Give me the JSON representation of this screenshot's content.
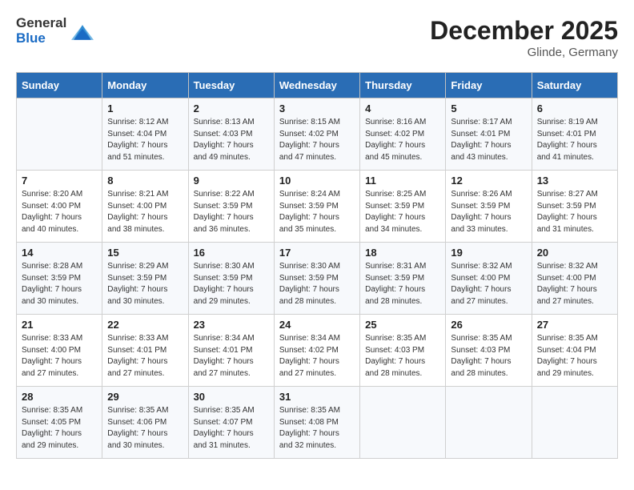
{
  "header": {
    "logo_general": "General",
    "logo_blue": "Blue",
    "month": "December 2025",
    "location": "Glinde, Germany"
  },
  "days_of_week": [
    "Sunday",
    "Monday",
    "Tuesday",
    "Wednesday",
    "Thursday",
    "Friday",
    "Saturday"
  ],
  "weeks": [
    [
      {
        "day": "",
        "sunrise": "",
        "sunset": "",
        "daylight": ""
      },
      {
        "day": "1",
        "sunrise": "Sunrise: 8:12 AM",
        "sunset": "Sunset: 4:04 PM",
        "daylight": "Daylight: 7 hours and 51 minutes."
      },
      {
        "day": "2",
        "sunrise": "Sunrise: 8:13 AM",
        "sunset": "Sunset: 4:03 PM",
        "daylight": "Daylight: 7 hours and 49 minutes."
      },
      {
        "day": "3",
        "sunrise": "Sunrise: 8:15 AM",
        "sunset": "Sunset: 4:02 PM",
        "daylight": "Daylight: 7 hours and 47 minutes."
      },
      {
        "day": "4",
        "sunrise": "Sunrise: 8:16 AM",
        "sunset": "Sunset: 4:02 PM",
        "daylight": "Daylight: 7 hours and 45 minutes."
      },
      {
        "day": "5",
        "sunrise": "Sunrise: 8:17 AM",
        "sunset": "Sunset: 4:01 PM",
        "daylight": "Daylight: 7 hours and 43 minutes."
      },
      {
        "day": "6",
        "sunrise": "Sunrise: 8:19 AM",
        "sunset": "Sunset: 4:01 PM",
        "daylight": "Daylight: 7 hours and 41 minutes."
      }
    ],
    [
      {
        "day": "7",
        "sunrise": "Sunrise: 8:20 AM",
        "sunset": "Sunset: 4:00 PM",
        "daylight": "Daylight: 7 hours and 40 minutes."
      },
      {
        "day": "8",
        "sunrise": "Sunrise: 8:21 AM",
        "sunset": "Sunset: 4:00 PM",
        "daylight": "Daylight: 7 hours and 38 minutes."
      },
      {
        "day": "9",
        "sunrise": "Sunrise: 8:22 AM",
        "sunset": "Sunset: 3:59 PM",
        "daylight": "Daylight: 7 hours and 36 minutes."
      },
      {
        "day": "10",
        "sunrise": "Sunrise: 8:24 AM",
        "sunset": "Sunset: 3:59 PM",
        "daylight": "Daylight: 7 hours and 35 minutes."
      },
      {
        "day": "11",
        "sunrise": "Sunrise: 8:25 AM",
        "sunset": "Sunset: 3:59 PM",
        "daylight": "Daylight: 7 hours and 34 minutes."
      },
      {
        "day": "12",
        "sunrise": "Sunrise: 8:26 AM",
        "sunset": "Sunset: 3:59 PM",
        "daylight": "Daylight: 7 hours and 33 minutes."
      },
      {
        "day": "13",
        "sunrise": "Sunrise: 8:27 AM",
        "sunset": "Sunset: 3:59 PM",
        "daylight": "Daylight: 7 hours and 31 minutes."
      }
    ],
    [
      {
        "day": "14",
        "sunrise": "Sunrise: 8:28 AM",
        "sunset": "Sunset: 3:59 PM",
        "daylight": "Daylight: 7 hours and 30 minutes."
      },
      {
        "day": "15",
        "sunrise": "Sunrise: 8:29 AM",
        "sunset": "Sunset: 3:59 PM",
        "daylight": "Daylight: 7 hours and 30 minutes."
      },
      {
        "day": "16",
        "sunrise": "Sunrise: 8:30 AM",
        "sunset": "Sunset: 3:59 PM",
        "daylight": "Daylight: 7 hours and 29 minutes."
      },
      {
        "day": "17",
        "sunrise": "Sunrise: 8:30 AM",
        "sunset": "Sunset: 3:59 PM",
        "daylight": "Daylight: 7 hours and 28 minutes."
      },
      {
        "day": "18",
        "sunrise": "Sunrise: 8:31 AM",
        "sunset": "Sunset: 3:59 PM",
        "daylight": "Daylight: 7 hours and 28 minutes."
      },
      {
        "day": "19",
        "sunrise": "Sunrise: 8:32 AM",
        "sunset": "Sunset: 4:00 PM",
        "daylight": "Daylight: 7 hours and 27 minutes."
      },
      {
        "day": "20",
        "sunrise": "Sunrise: 8:32 AM",
        "sunset": "Sunset: 4:00 PM",
        "daylight": "Daylight: 7 hours and 27 minutes."
      }
    ],
    [
      {
        "day": "21",
        "sunrise": "Sunrise: 8:33 AM",
        "sunset": "Sunset: 4:00 PM",
        "daylight": "Daylight: 7 hours and 27 minutes."
      },
      {
        "day": "22",
        "sunrise": "Sunrise: 8:33 AM",
        "sunset": "Sunset: 4:01 PM",
        "daylight": "Daylight: 7 hours and 27 minutes."
      },
      {
        "day": "23",
        "sunrise": "Sunrise: 8:34 AM",
        "sunset": "Sunset: 4:01 PM",
        "daylight": "Daylight: 7 hours and 27 minutes."
      },
      {
        "day": "24",
        "sunrise": "Sunrise: 8:34 AM",
        "sunset": "Sunset: 4:02 PM",
        "daylight": "Daylight: 7 hours and 27 minutes."
      },
      {
        "day": "25",
        "sunrise": "Sunrise: 8:35 AM",
        "sunset": "Sunset: 4:03 PM",
        "daylight": "Daylight: 7 hours and 28 minutes."
      },
      {
        "day": "26",
        "sunrise": "Sunrise: 8:35 AM",
        "sunset": "Sunset: 4:03 PM",
        "daylight": "Daylight: 7 hours and 28 minutes."
      },
      {
        "day": "27",
        "sunrise": "Sunrise: 8:35 AM",
        "sunset": "Sunset: 4:04 PM",
        "daylight": "Daylight: 7 hours and 29 minutes."
      }
    ],
    [
      {
        "day": "28",
        "sunrise": "Sunrise: 8:35 AM",
        "sunset": "Sunset: 4:05 PM",
        "daylight": "Daylight: 7 hours and 29 minutes."
      },
      {
        "day": "29",
        "sunrise": "Sunrise: 8:35 AM",
        "sunset": "Sunset: 4:06 PM",
        "daylight": "Daylight: 7 hours and 30 minutes."
      },
      {
        "day": "30",
        "sunrise": "Sunrise: 8:35 AM",
        "sunset": "Sunset: 4:07 PM",
        "daylight": "Daylight: 7 hours and 31 minutes."
      },
      {
        "day": "31",
        "sunrise": "Sunrise: 8:35 AM",
        "sunset": "Sunset: 4:08 PM",
        "daylight": "Daylight: 7 hours and 32 minutes."
      },
      {
        "day": "",
        "sunrise": "",
        "sunset": "",
        "daylight": ""
      },
      {
        "day": "",
        "sunrise": "",
        "sunset": "",
        "daylight": ""
      },
      {
        "day": "",
        "sunrise": "",
        "sunset": "",
        "daylight": ""
      }
    ]
  ]
}
